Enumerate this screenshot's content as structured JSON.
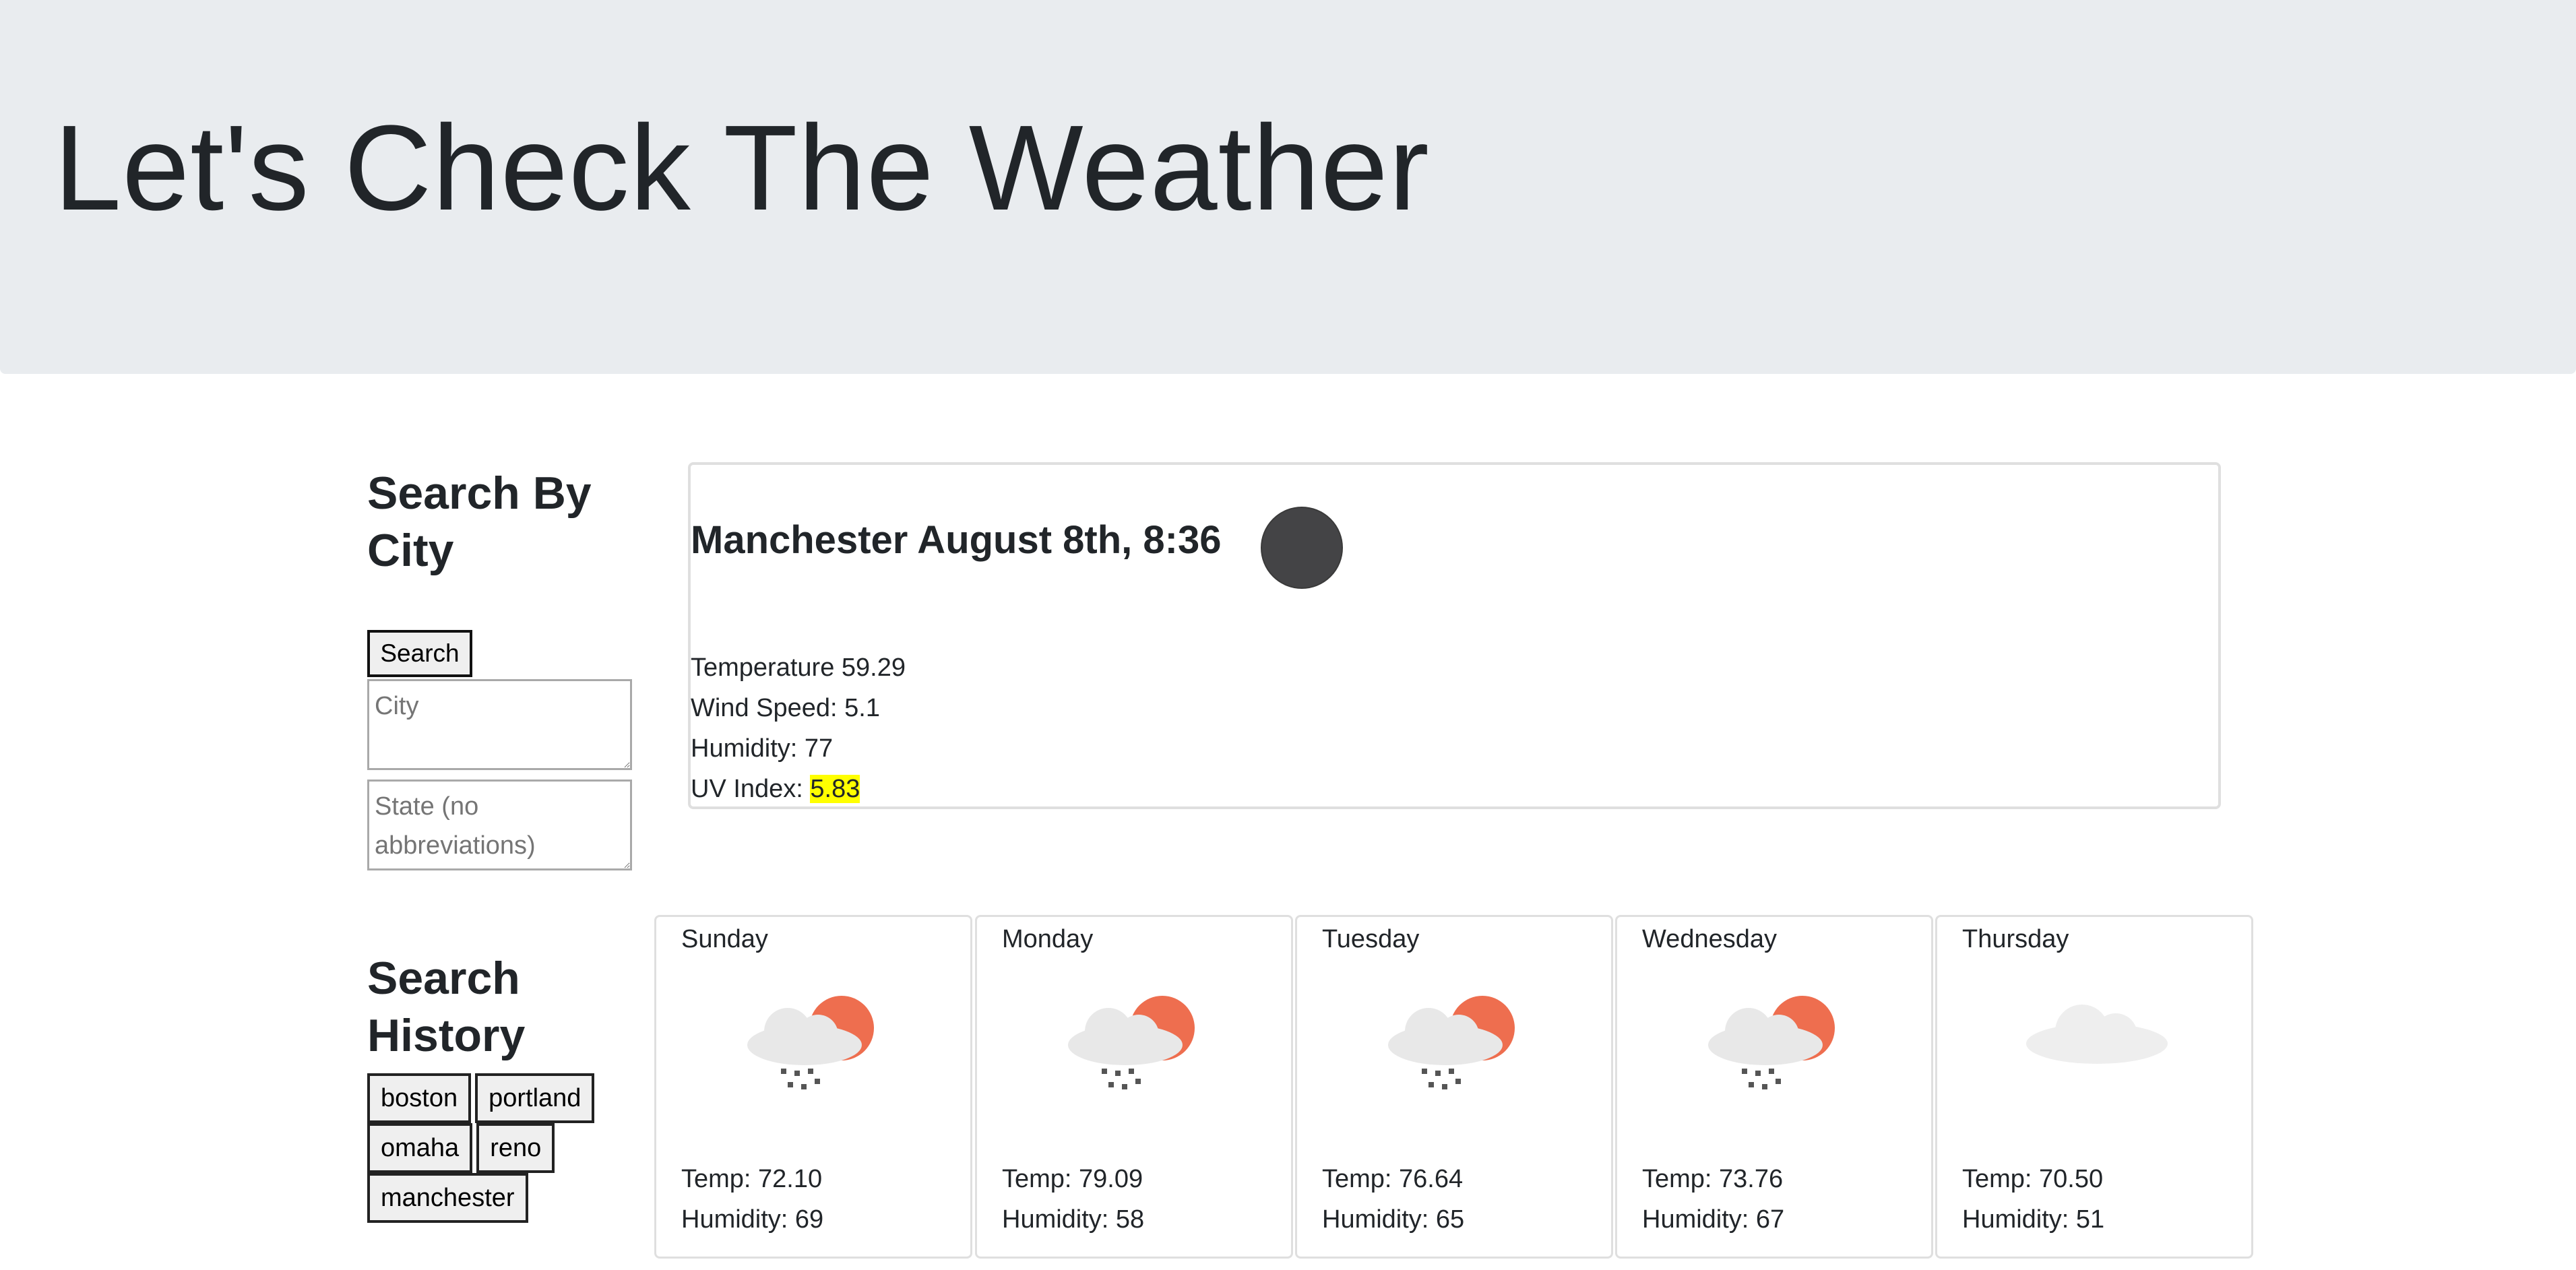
{
  "header": {
    "title": "Let's Check The Weather"
  },
  "search": {
    "heading": "Search By City",
    "button_label": "Search",
    "city_placeholder": "City",
    "state_placeholder": "State (no abbreviations)"
  },
  "current": {
    "title": "Manchester August 8th, 8:36",
    "icon": "weather-icon",
    "temperature": "Temperature 59.29",
    "wind": "Wind Speed: 5.1",
    "humidity": "Humidity: 77",
    "uv_label": "UV Index: ",
    "uv_value": "5.83",
    "uv_color": "#ffff00"
  },
  "history": {
    "heading": "Search History",
    "items": [
      "boston",
      "portland",
      "omaha",
      "reno",
      "manchester"
    ]
  },
  "forecast": [
    {
      "day": "Sunday",
      "icon": "rain-partly-cloudy-icon",
      "temp": "Temp: 72.10",
      "humidity": "Humidity: 69"
    },
    {
      "day": "Monday",
      "icon": "rain-partly-cloudy-icon",
      "temp": "Temp: 79.09",
      "humidity": "Humidity: 58"
    },
    {
      "day": "Tuesday",
      "icon": "rain-partly-cloudy-icon",
      "temp": "Temp: 76.64",
      "humidity": "Humidity: 65"
    },
    {
      "day": "Wednesday",
      "icon": "rain-partly-cloudy-icon",
      "temp": "Temp: 73.76",
      "humidity": "Humidity: 67"
    },
    {
      "day": "Thursday",
      "icon": "cloud-icon",
      "temp": "Temp: 70.50",
      "humidity": "Humidity: 51"
    }
  ]
}
